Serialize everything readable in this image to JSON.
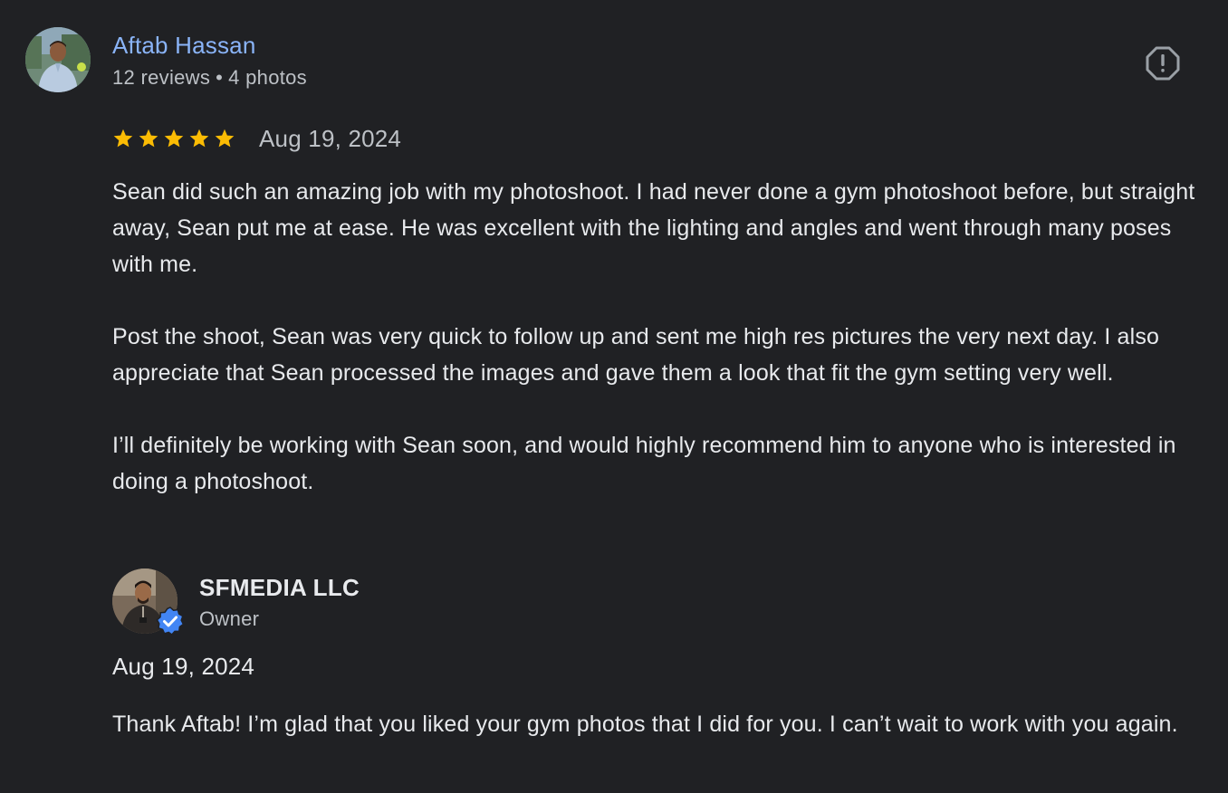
{
  "reviewer": {
    "name": "Aftab Hassan",
    "reviews": "12 reviews",
    "separator": "•",
    "photos": "4 photos",
    "avatar_icon": "profile-photo"
  },
  "review": {
    "rating": 5,
    "max_rating": 5,
    "star_color": "#fbbc04",
    "date": "Aug 19, 2024",
    "paragraphs": [
      "Sean did such an amazing job with my photoshoot. I had never done a gym photoshoot before, but straight away, Sean put me at ease. He was excellent with the lighting and angles and went through many poses with me.",
      "Post the shoot, Sean was very quick to follow up and sent me high res pictures the very next day. I also appreciate that Sean processed the images and gave them a look that fit the gym setting very well.",
      "I’ll definitely be working with Sean soon, and would highly recommend him to anyone who is interested in doing a photoshoot."
    ]
  },
  "actions": {
    "flag_icon": "report-icon"
  },
  "owner_reply": {
    "name": "SFMEDIA LLC",
    "role": "Owner",
    "verified_icon": "verified-badge-icon",
    "badge_color": "#4285f4",
    "date": "Aug 19, 2024",
    "text": "Thank Aftab! I’m glad that you liked your gym photos that I did for you. I can’t wait to work with you again."
  },
  "colors": {
    "background": "#202124",
    "link": "#8ab4f8",
    "text": "#e8eaed",
    "muted": "#bdc1c6"
  }
}
